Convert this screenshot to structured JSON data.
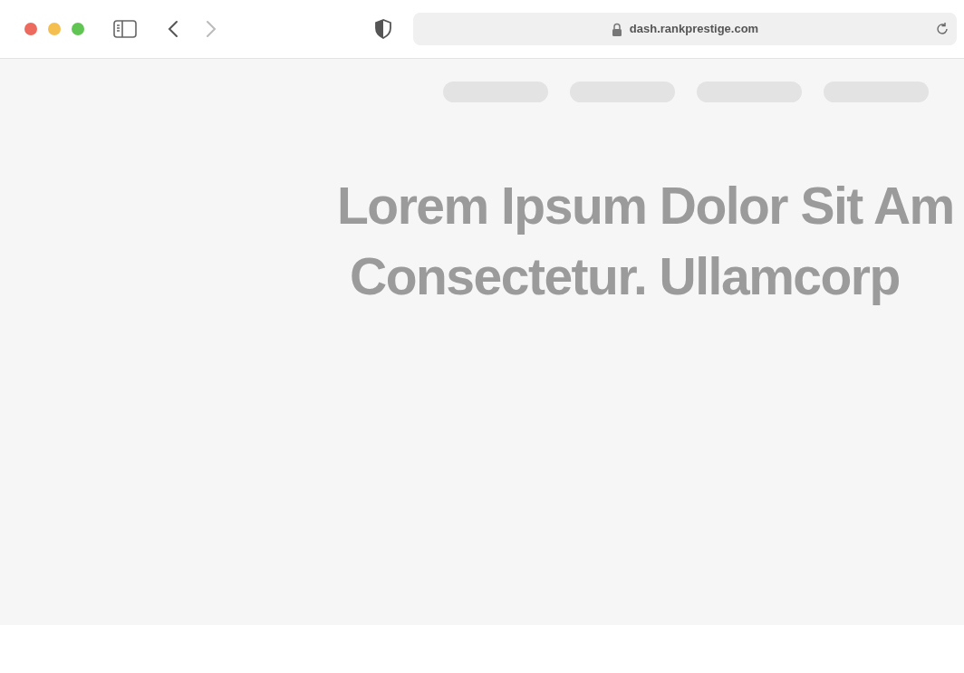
{
  "browser": {
    "address": "dash.rankprestige.com",
    "back_enabled": true,
    "forward_enabled": false
  },
  "page": {
    "headline_lines": [
      "Lorem Ipsum Dolor Sit Am",
      "Consectetur. Ullamcorp"
    ]
  }
}
